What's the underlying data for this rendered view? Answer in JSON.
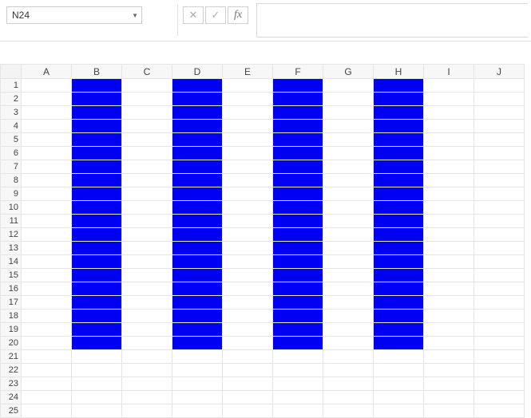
{
  "formula_bar": {
    "name_box_value": "N24",
    "cancel_symbol": "✕",
    "confirm_symbol": "✓",
    "fx_label": "fx",
    "formula_value": ""
  },
  "sheet": {
    "columns": [
      "A",
      "B",
      "C",
      "D",
      "E",
      "F",
      "G",
      "H",
      "I",
      "J"
    ],
    "rows": [
      "1",
      "2",
      "3",
      "4",
      "5",
      "6",
      "7",
      "8",
      "9",
      "10",
      "11",
      "12",
      "13",
      "14",
      "15",
      "16",
      "17",
      "18",
      "19",
      "20",
      "21",
      "22",
      "23",
      "24",
      "25"
    ],
    "filled_columns": [
      "B",
      "D",
      "F",
      "H"
    ],
    "fill_row_start": 1,
    "fill_row_end": 20,
    "fill_color": "#0000f2"
  }
}
